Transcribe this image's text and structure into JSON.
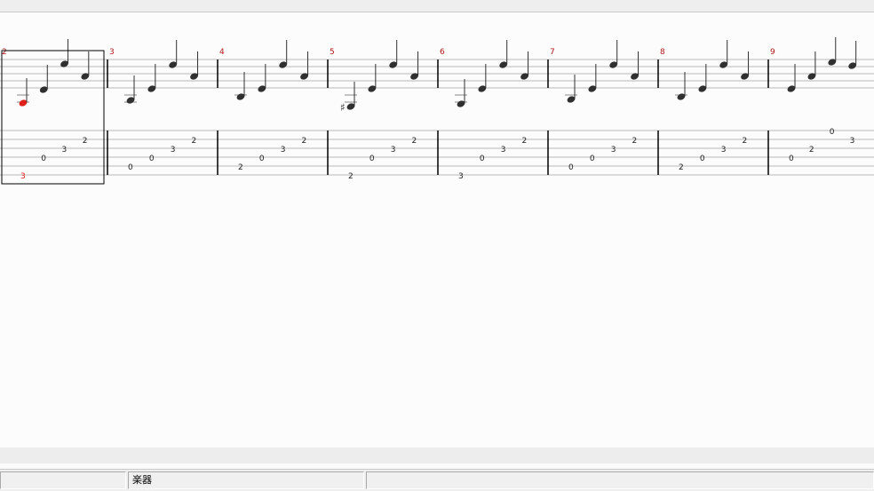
{
  "window": {
    "status_instrument_label": "楽器"
  },
  "score": {
    "selected_measure_index": 0,
    "highlight_color": "#e0201a",
    "measure_number_color": "#b01818",
    "strings": 6,
    "measures": [
      {
        "number": "2",
        "tab": [
          {
            "string": 6,
            "fret": "3"
          },
          {
            "string": 4,
            "fret": "0"
          },
          {
            "string": 3,
            "fret": "3"
          },
          {
            "string": 2,
            "fret": "2"
          }
        ],
        "accidental": ""
      },
      {
        "number": "3",
        "tab": [
          {
            "string": 5,
            "fret": "0"
          },
          {
            "string": 4,
            "fret": "0"
          },
          {
            "string": 3,
            "fret": "3"
          },
          {
            "string": 2,
            "fret": "2"
          }
        ],
        "accidental": ""
      },
      {
        "number": "4",
        "tab": [
          {
            "string": 5,
            "fret": "2"
          },
          {
            "string": 4,
            "fret": "0"
          },
          {
            "string": 3,
            "fret": "3"
          },
          {
            "string": 2,
            "fret": "2"
          }
        ],
        "accidental": ""
      },
      {
        "number": "5",
        "tab": [
          {
            "string": 6,
            "fret": "2"
          },
          {
            "string": 4,
            "fret": "0"
          },
          {
            "string": 3,
            "fret": "3"
          },
          {
            "string": 2,
            "fret": "2"
          }
        ],
        "accidental": "♯"
      },
      {
        "number": "6",
        "tab": [
          {
            "string": 6,
            "fret": "3"
          },
          {
            "string": 4,
            "fret": "0"
          },
          {
            "string": 3,
            "fret": "3"
          },
          {
            "string": 2,
            "fret": "2"
          }
        ],
        "accidental": ""
      },
      {
        "number": "7",
        "tab": [
          {
            "string": 5,
            "fret": "0"
          },
          {
            "string": 4,
            "fret": "0"
          },
          {
            "string": 3,
            "fret": "3"
          },
          {
            "string": 2,
            "fret": "2"
          }
        ],
        "accidental": ""
      },
      {
        "number": "8",
        "tab": [
          {
            "string": 5,
            "fret": "2"
          },
          {
            "string": 4,
            "fret": "0"
          },
          {
            "string": 3,
            "fret": "3"
          },
          {
            "string": 2,
            "fret": "2"
          }
        ],
        "accidental": ""
      },
      {
        "number": "9",
        "tab": [
          {
            "string": 4,
            "fret": "0"
          },
          {
            "string": 3,
            "fret": "2"
          },
          {
            "string": 1,
            "fret": "0"
          },
          {
            "string": 2,
            "fret": "3"
          }
        ],
        "accidental": ""
      }
    ]
  }
}
